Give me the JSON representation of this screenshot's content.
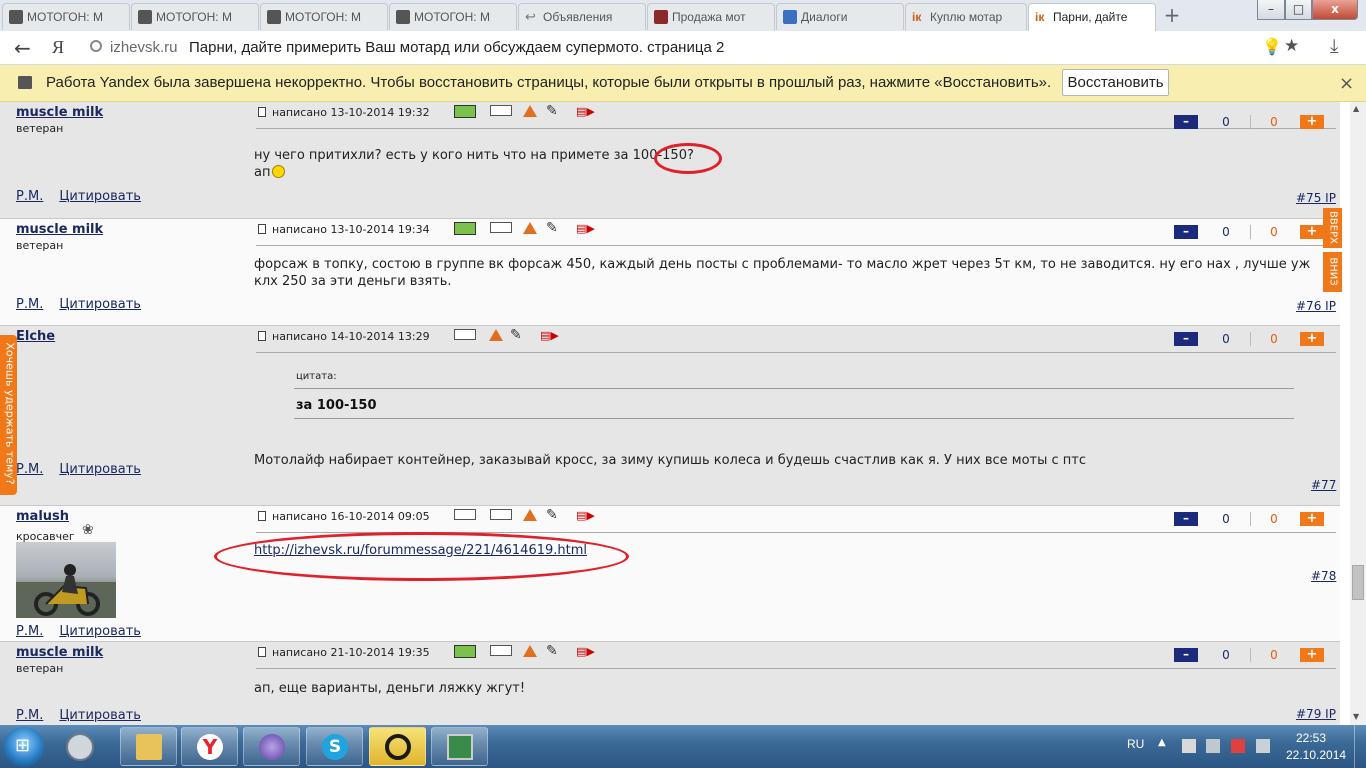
{
  "browser": {
    "tabs": [
      {
        "label": "МОТОГОН: М",
        "icon": "motogon-icon",
        "color": "#555555"
      },
      {
        "label": "МОТОГОН: М",
        "icon": "motogon-icon",
        "color": "#555555"
      },
      {
        "label": "МОТОГОН: М",
        "icon": "motogon-icon",
        "color": "#555555"
      },
      {
        "label": "МОТОГОН: М",
        "icon": "motogon-icon",
        "color": "#555555"
      },
      {
        "label": "Объявления",
        "icon": "back-arrow-icon",
        "color": "#777777"
      },
      {
        "label": "Продажа мот",
        "icon": "site-icon",
        "color": "#8a2a2a"
      },
      {
        "label": "Диалоги",
        "icon": "chat-icon",
        "color": "#3a6fc2"
      },
      {
        "label": "Куплю мотар",
        "icon": "izhevsk-icon",
        "color": "#d0601a"
      },
      {
        "label": "Парни, дайте",
        "icon": "izhevsk-icon",
        "color": "#d0601a"
      }
    ],
    "new_tab": "+",
    "window_buttons": {
      "minimize": "–",
      "maximize": "□",
      "close": "x"
    },
    "address": {
      "back": "←",
      "logo": "Я",
      "domain": "izhevsk.ru",
      "title": "Парни, дайте примерить Ваш мотард или обсуждаем супермото. страница 2"
    },
    "infobar": {
      "text": "Работа Yandex была завершена некорректно. Чтобы восстановить страницы, которые были открыты в прошлый раз, нажмите «Восстановить».",
      "button": "Восстановить",
      "close": "×"
    }
  },
  "forum": {
    "links": {
      "pm": "Р.М.",
      "quote": "Цитировать"
    },
    "posts": [
      {
        "author": "muscle milk",
        "rank": "ветеран",
        "date": "написано 13-10-2014 19:32",
        "votes_minus": "0",
        "votes_plus": "0",
        "lines": [
          "ну чего притихли? есть у кого нить что на примете за 100-150?",
          "ап"
        ],
        "num": "#75",
        "ip": "IP"
      },
      {
        "author": "muscle milk",
        "rank": "ветеран",
        "date": "написано 13-10-2014 19:34",
        "votes_minus": "0",
        "votes_plus": "0",
        "lines": [
          "форсаж в топку, состою в группе вк форсаж 450, каждый день посты с проблемами- то масло жрет через 5т км, то не заводится. ну его нах , лучше уж",
          "клх 250 за эти деньги взять."
        ],
        "num": "#76",
        "ip": "IP"
      },
      {
        "author": "Elche",
        "rank": "",
        "date": "написано 14-10-2014 13:29",
        "votes_minus": "0",
        "votes_plus": "0",
        "quote_label": "цитата:",
        "quote_text": "за 100-150",
        "lines": [
          "Мотолайф набирает контейнер, заказывай кросс, за зиму купишь колеса и будешь счастлив как я. У них все моты с птс"
        ],
        "num": "#77",
        "ip": ""
      },
      {
        "author": "malush",
        "rank": "кросавчег",
        "date": "написано 16-10-2014 09:05",
        "votes_minus": "0",
        "votes_plus": "0",
        "link": "http://izhevsk.ru/forummessage/221/4614619.html",
        "num": "#78",
        "ip": ""
      },
      {
        "author": "muscle milk",
        "rank": "ветеран",
        "date": "написано 21-10-2014 19:35",
        "votes_minus": "0",
        "votes_plus": "0",
        "lines": [
          "ап, еще варианты, деньги ляжку жгут!"
        ],
        "num": "#79",
        "ip": "IP"
      }
    ],
    "vote_labels": {
      "minus": "–",
      "plus": "+"
    },
    "side_tabs": {
      "left": "Хочешь удержать тему?",
      "up": "ВВЕРХ",
      "down": "ВНИЗ"
    },
    "colors": {
      "accent": "#f07818",
      "link": "#19285e",
      "annotation": "#e0202a"
    }
  },
  "taskbar": {
    "apps": [
      "explorer-icon",
      "yandex-browser-icon",
      "media-icon",
      "skype-icon",
      "app-icon",
      "monitor-icon"
    ],
    "lang": "RU",
    "time": "22:53",
    "date": "22.10.2014"
  }
}
